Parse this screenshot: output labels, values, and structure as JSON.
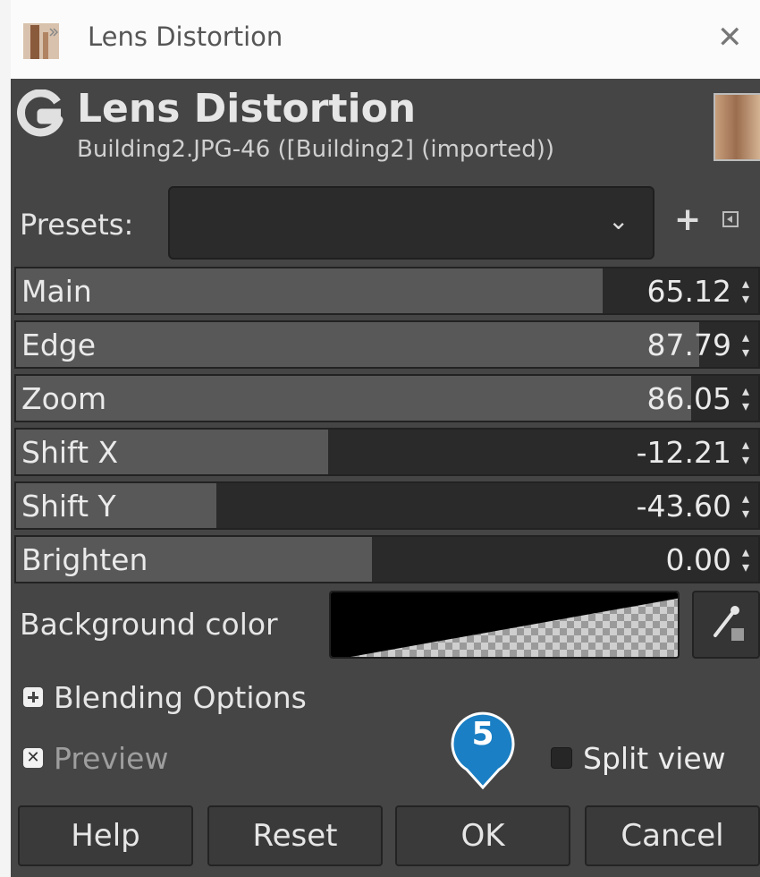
{
  "window": {
    "title": "Lens Distortion",
    "close_glyph": "✕"
  },
  "header": {
    "title": "Lens Distortion",
    "subtitle": "Building2.JPG-46 ([Building2] (imported))"
  },
  "presets": {
    "label": "Presets:",
    "value": "",
    "chevron": "⌄",
    "add_glyph": "+"
  },
  "sliders": [
    {
      "label": "Main",
      "value": "65.12",
      "fill_percent": 79
    },
    {
      "label": "Edge",
      "value": "87.79",
      "fill_percent": 92
    },
    {
      "label": "Zoom",
      "value": "86.05",
      "fill_percent": 91
    },
    {
      "label": "Shift X",
      "value": "-12.21",
      "fill_percent": 42
    },
    {
      "label": "Shift Y",
      "value": "-43.60",
      "fill_percent": 27
    },
    {
      "label": "Brighten",
      "value": "0.00",
      "fill_percent": 48
    }
  ],
  "background": {
    "label": "Background color",
    "color": "#000000"
  },
  "blending": {
    "label": "Blending Options"
  },
  "preview": {
    "label": "Preview",
    "checked": true,
    "check_glyph": "✕"
  },
  "split_view": {
    "label": "Split view",
    "checked": false
  },
  "callout": {
    "number": "5",
    "color": "#1a7fc4"
  },
  "buttons": {
    "help": "Help",
    "reset": "Reset",
    "ok": "OK",
    "cancel": "Cancel"
  }
}
